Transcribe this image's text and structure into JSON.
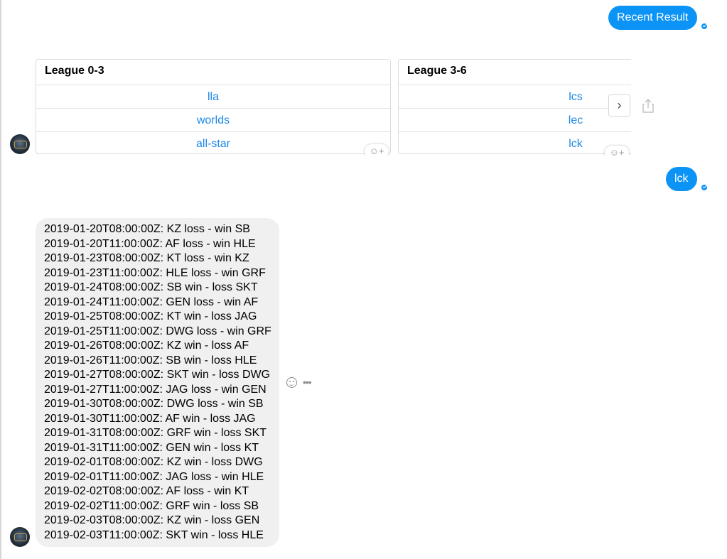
{
  "messages": {
    "user_1": "Recent Result",
    "user_2": "lck"
  },
  "carousel": {
    "cards": [
      {
        "title": "League 0-3",
        "buttons": [
          "lla",
          "worlds",
          "all-star"
        ]
      },
      {
        "title": "League 3-6",
        "buttons": [
          "lcs",
          "lec",
          "lck"
        ]
      }
    ],
    "next_arrow": "›"
  },
  "results": [
    "2019-01-20T08:00:00Z: KZ loss - win SB",
    "2019-01-20T11:00:00Z: AF loss - win HLE",
    "2019-01-23T08:00:00Z: KT loss - win KZ",
    "2019-01-23T11:00:00Z: HLE loss - win GRF",
    "2019-01-24T08:00:00Z: SB win - loss SKT",
    "2019-01-24T11:00:00Z: GEN loss - win AF",
    "2019-01-25T08:00:00Z: KT win - loss JAG",
    "2019-01-25T11:00:00Z: DWG loss - win GRF",
    "2019-01-26T08:00:00Z: KZ win - loss AF",
    "2019-01-26T11:00:00Z: SB win - loss HLE",
    "2019-01-27T08:00:00Z: SKT win - loss DWG",
    "2019-01-27T11:00:00Z: JAG loss - win GEN",
    "2019-01-30T08:00:00Z: DWG loss - win SB",
    "2019-01-30T11:00:00Z: AF win - loss JAG",
    "2019-01-31T08:00:00Z: GRF win - loss SKT",
    "2019-01-31T11:00:00Z: GEN win - loss KT",
    "2019-02-01T08:00:00Z: KZ win - loss DWG",
    "2019-02-01T11:00:00Z: JAG loss - win HLE",
    "2019-02-02T08:00:00Z: AF loss - win KT",
    "2019-02-02T11:00:00Z: GRF win - loss SB",
    "2019-02-03T08:00:00Z: KZ win - loss GEN",
    "2019-02-03T11:00:00Z: SKT win - loss HLE"
  ],
  "icons": {
    "seen": "seen-check-icon",
    "reaction": "add-reaction-icon",
    "share": "share-icon",
    "more": "more-options-icon",
    "avatar": "bot-avatar"
  },
  "colors": {
    "accent": "#0b93f6",
    "link": "#1e88e5",
    "bot_bubble": "#f1f0f0"
  }
}
